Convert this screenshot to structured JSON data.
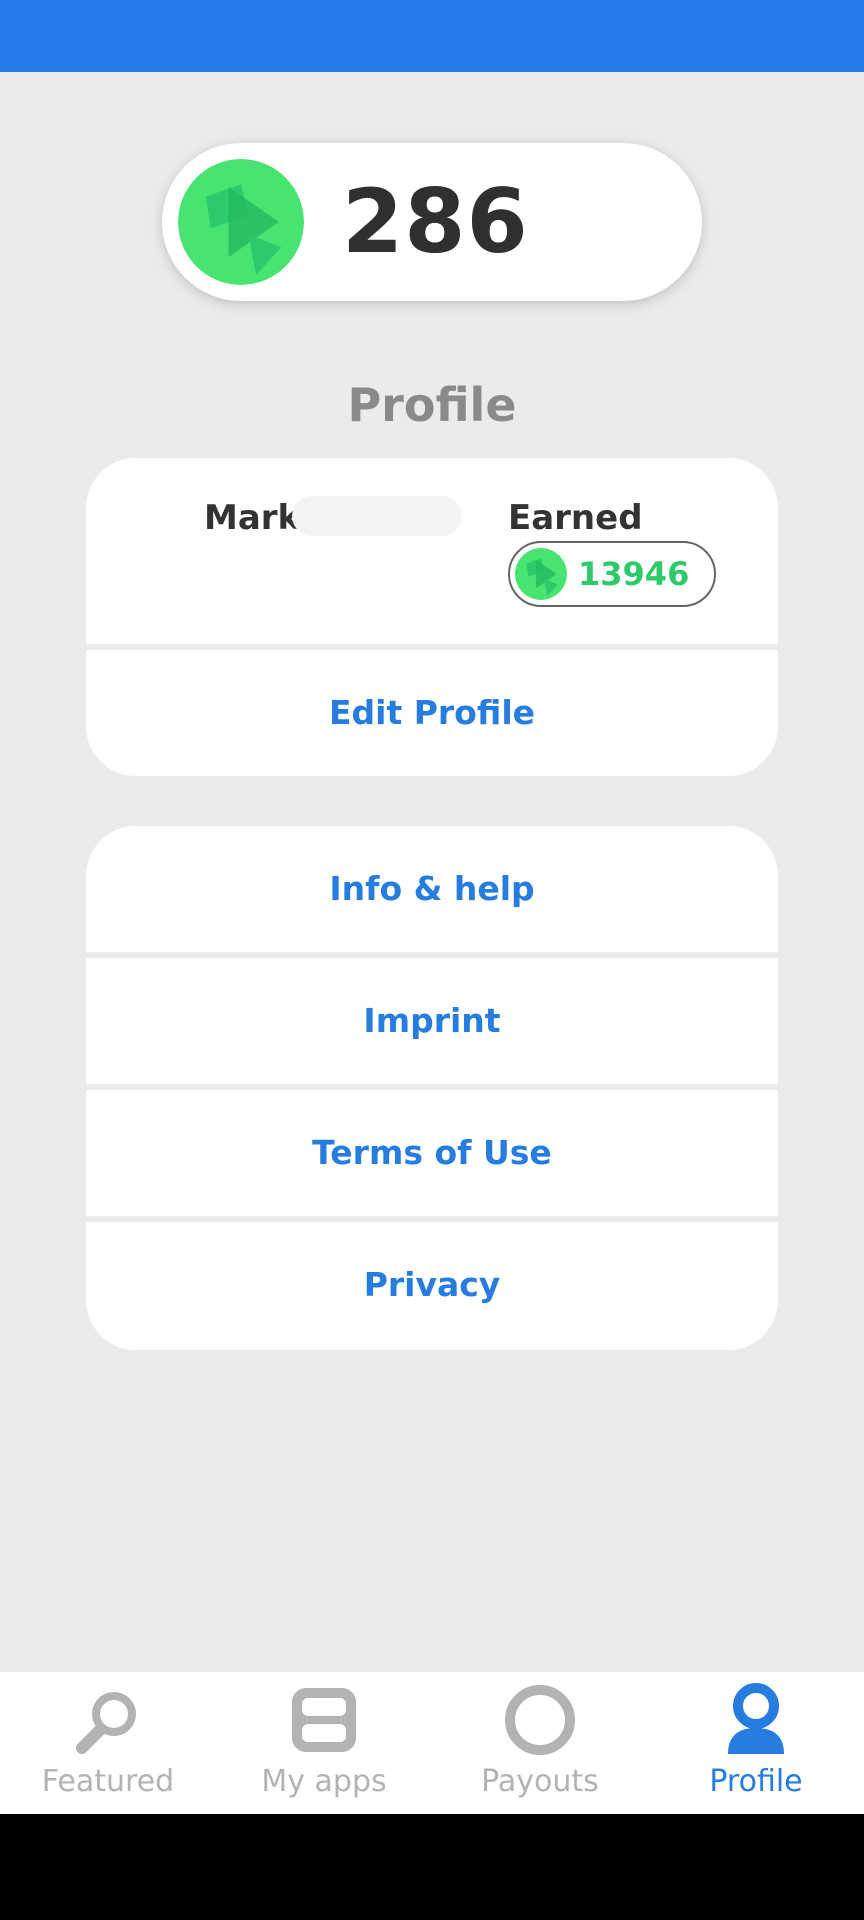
{
  "colors": {
    "status_bar": "#277ced",
    "accent_blue": "#277ce0",
    "coin_green": "#2ec96a",
    "background": "#ebebeb",
    "inactive_nav": "#b3b3b3"
  },
  "balance": {
    "value": "286",
    "icon": "coin-icon"
  },
  "profile": {
    "title": "Profile",
    "user_name": "Mark",
    "earned_label": "Earned",
    "earned_value": "13946",
    "edit_label": "Edit Profile"
  },
  "links": [
    {
      "label": "Info & help"
    },
    {
      "label": "Imprint"
    },
    {
      "label": "Terms of Use"
    },
    {
      "label": "Privacy"
    }
  ],
  "nav": {
    "items": [
      {
        "label": "Featured",
        "icon": "search-icon",
        "active": false
      },
      {
        "label": "My apps",
        "icon": "apps-icon",
        "active": false
      },
      {
        "label": "Payouts",
        "icon": "circle-icon",
        "active": false
      },
      {
        "label": "Profile",
        "icon": "user-icon",
        "active": true
      }
    ]
  }
}
